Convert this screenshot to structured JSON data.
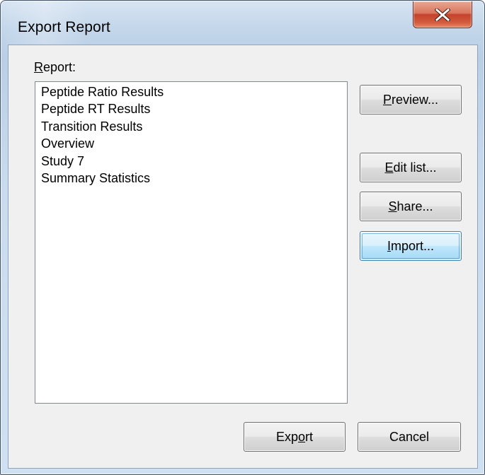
{
  "window": {
    "title": "Export Report",
    "close_glyph": "X",
    "close_icon": "close-icon"
  },
  "report": {
    "label_mnemonic": "R",
    "label_rest": "eport:",
    "items": [
      "Peptide Ratio Results",
      "Peptide RT Results",
      "Transition Results",
      "Overview",
      "Study 7",
      "Summary Statistics"
    ]
  },
  "buttons": {
    "preview": {
      "mnemonic": "P",
      "rest": "review..."
    },
    "edit_list": {
      "mnemonic": "E",
      "rest": "dit list..."
    },
    "share": {
      "mnemonic": "S",
      "rest": "hare..."
    },
    "import": {
      "mnemonic": "I",
      "rest": "mport..."
    },
    "export": {
      "before": "Exp",
      "mnemonic": "o",
      "after": "rt"
    },
    "cancel": {
      "label": "Cancel"
    }
  },
  "colors": {
    "close_button": "#c94a2f",
    "focus_border": "#3c7fb1",
    "dialog_face": "#f0f0f0"
  }
}
